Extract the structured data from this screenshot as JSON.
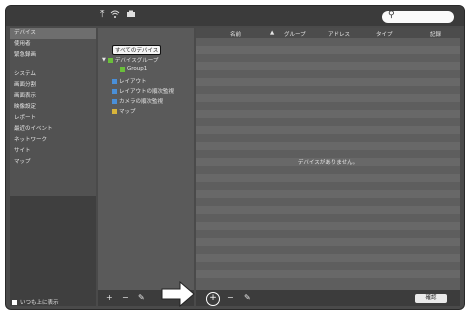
{
  "toolbar": {
    "icons": [
      "upload-icon",
      "wifi-icon",
      "camera-icon"
    ],
    "search_placeholder": ""
  },
  "sidebar": {
    "group1": [
      "デバイス",
      "使用者",
      "緊急録画"
    ],
    "group2": [
      "システム",
      "画面分割",
      "画面表示",
      "映像設定",
      "レポート",
      "最近のイベント",
      "ネットワーク",
      "サイト",
      "マップ"
    ],
    "always_on_top": "いつも上に表示"
  },
  "tree": {
    "all_devices": "すべてのデバイス",
    "device_group": "デバイスグループ",
    "group1": "Group1",
    "layout": "レイアウト",
    "layout_sequence": "レイアウトの順次監視",
    "camera_sequence": "カメラの順次監視",
    "map": "マップ"
  },
  "table": {
    "columns": [
      "名前",
      "グループ",
      "アドレス",
      "タイプ",
      "記録"
    ],
    "empty_message": "デバイスがありません。",
    "confirm": "確認"
  },
  "colors": {
    "window_bg": "#4a4a4a",
    "group_green": "#6abf3a",
    "layout_blue": "#4a8fd8",
    "map_yellow": "#d8b43a"
  }
}
